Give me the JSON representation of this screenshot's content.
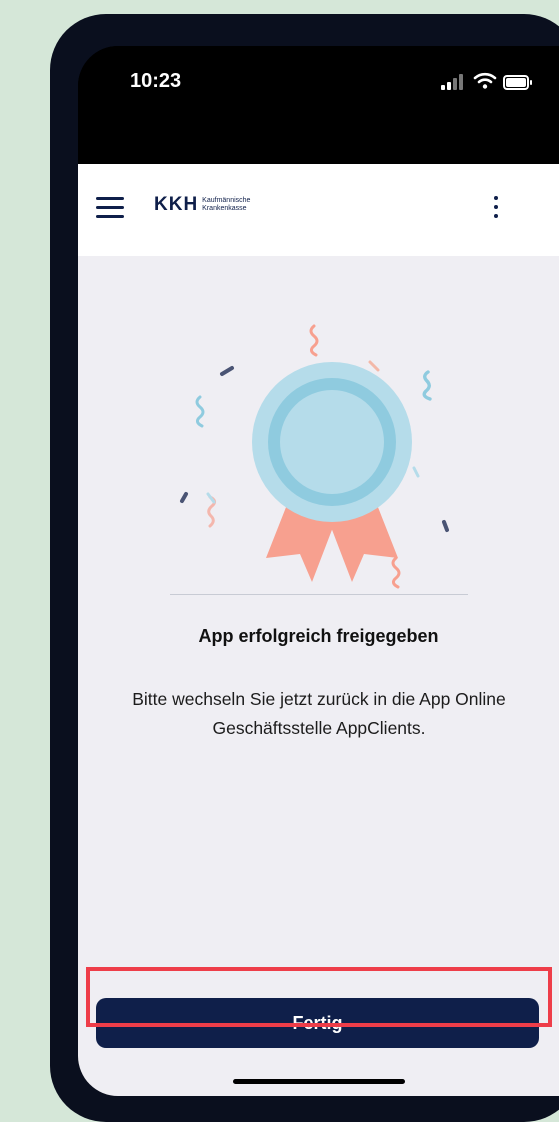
{
  "status_bar": {
    "time": "10:23"
  },
  "app_bar": {
    "logo_mark": "KKH",
    "logo_line1": "Kaufmännische",
    "logo_line2": "Krankenkasse"
  },
  "main": {
    "heading": "App erfolgreich freigegeben",
    "body_line1": "Bitte wechseln Sie jetzt zurück in die App Online",
    "body_line2": "Geschäftsstelle AppClients.",
    "done_label": "Fertig"
  },
  "colors": {
    "brand_navy": "#0f1f4a",
    "highlight": "#ee3d49",
    "medal_light": "#b5dcea",
    "medal_dark": "#8fcbdf",
    "ribbon": "#f7a08f"
  }
}
